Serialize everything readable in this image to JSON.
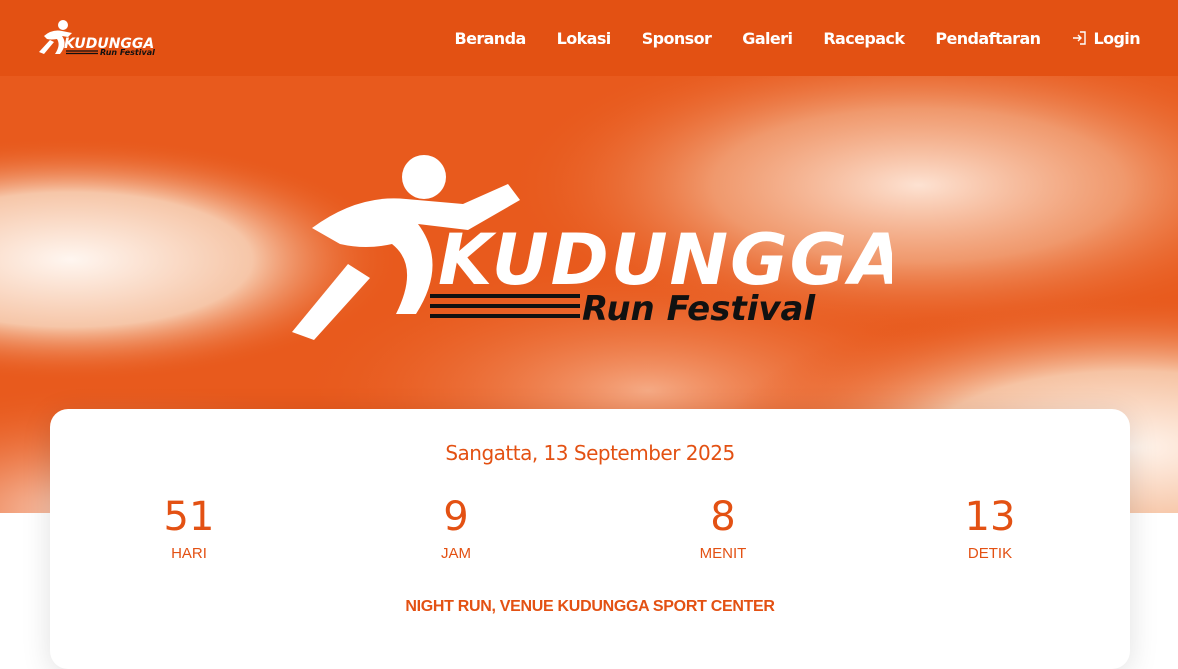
{
  "navbar": {
    "logo": {
      "title": "KUDUNGGA",
      "subtitle": "Run Festival"
    },
    "links": [
      "Beranda",
      "Lokasi",
      "Sponsor",
      "Galeri",
      "Racepack",
      "Pendaftaran"
    ],
    "login_label": "Login",
    "login_icon": "login-icon",
    "background": "#e35113"
  },
  "hero": {
    "logo": {
      "title": "KUDUNGGA",
      "subtitle": "Run Festival"
    },
    "accent": "#e85a1d"
  },
  "event": {
    "date": "Sangatta, 13 September 2025",
    "countdown": [
      {
        "value": "51",
        "label": "HARI"
      },
      {
        "value": "9",
        "label": "JAM"
      },
      {
        "value": "8",
        "label": "MENIT"
      },
      {
        "value": "13",
        "label": "DETIK"
      }
    ],
    "note": "NIGHT RUN, VENUE KUDUNGGA SPORT CENTER"
  }
}
